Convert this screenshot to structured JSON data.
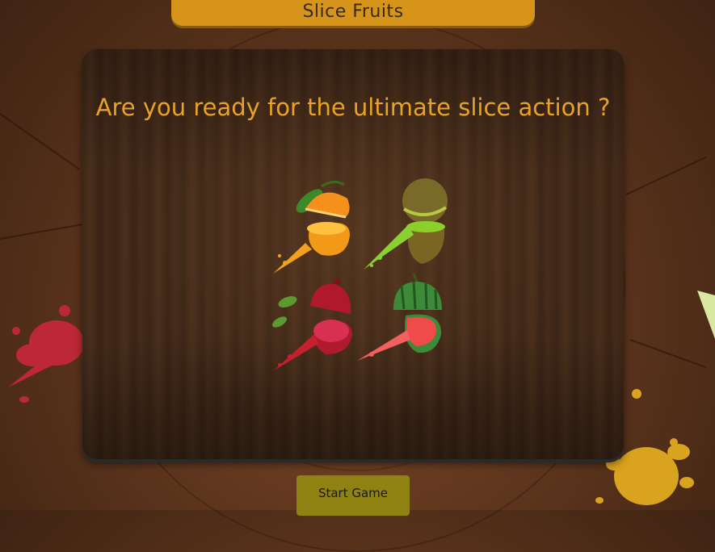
{
  "header": {
    "title": "Slice Fruits"
  },
  "intro": {
    "question": "Are you ready for the ultimate slice action ?"
  },
  "fruits": [
    "orange",
    "kiwi",
    "pomegranate",
    "watermelon"
  ],
  "controls": {
    "start_label": "Start Game"
  },
  "colors": {
    "title_bar": "#d7941b",
    "question_text": "#e8a326",
    "start_button": "#8f8212",
    "wood_background": "#6a3d22",
    "panel": "#3e2717"
  }
}
